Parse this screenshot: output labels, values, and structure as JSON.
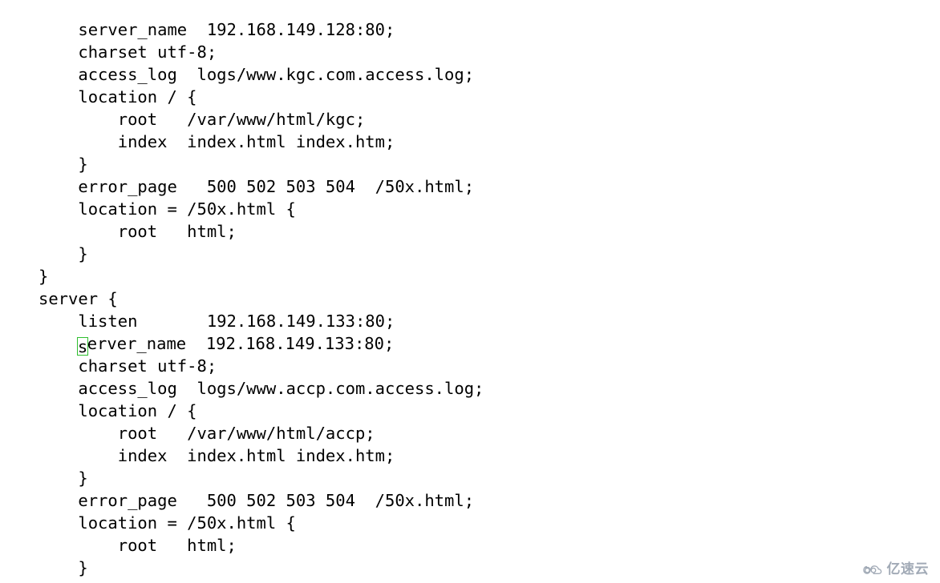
{
  "editor": {
    "background_color": "#ffffff",
    "text_color": "#000000",
    "cursor_color": "#2fbf2f",
    "lines": [
      "    server_name  192.168.149.128:80;",
      "    charset utf-8;",
      "    access_log  logs/www.kgc.com.access.log;",
      "    location / {",
      "        root   /var/www/html/kgc;",
      "        index  index.html index.htm;",
      "    }",
      "    error_page   500 502 503 504  /50x.html;",
      "    location = /50x.html {",
      "        root   html;",
      "    }",
      "}",
      "server {",
      "    listen       192.168.149.133:80;",
      "    server_name  192.168.149.133:80;",
      "    charset utf-8;",
      "    access_log  logs/www.accp.com.access.log;",
      "    location / {",
      "        root   /var/www/html/accp;",
      "        index  index.html index.htm;",
      "    }",
      "    error_page   500 502 503 504  /50x.html;",
      "    location = /50x.html {",
      "        root   html;",
      "    }"
    ],
    "cursor": {
      "line_index": 14,
      "column_index": 4,
      "character": "s"
    }
  },
  "watermark": {
    "text": "亿速云",
    "icon": "cloud-logo-icon",
    "color": "#9aa3b0"
  }
}
